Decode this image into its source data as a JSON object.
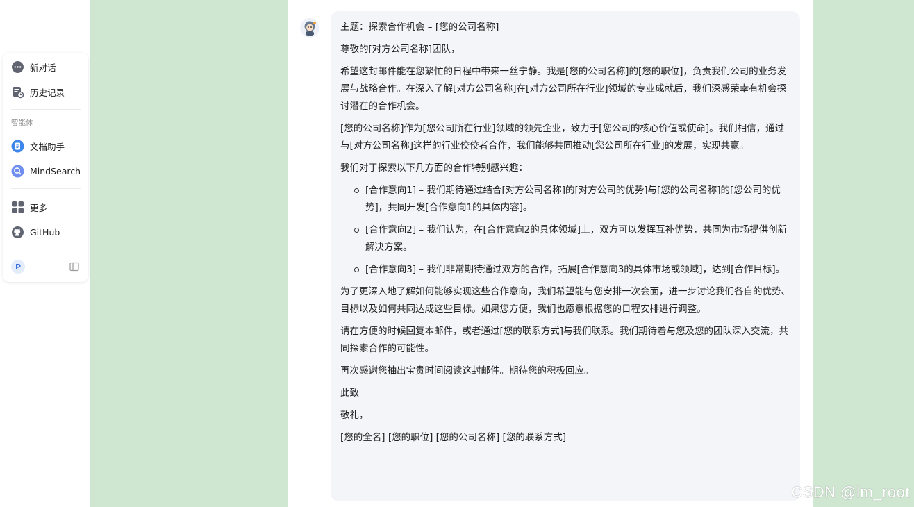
{
  "sidebar": {
    "new_chat": "新对话",
    "history": "历史记录",
    "section_agents": "智能体",
    "doc_assistant": "文档助手",
    "mindsearch": "MindSearch",
    "more": "更多",
    "github": "GitHub",
    "user_initial": "P"
  },
  "message": {
    "subject": "主题：探索合作机会 – [您的公司名称]",
    "greeting": "尊敬的[对方公司名称]团队，",
    "para1": "希望这封邮件能在您繁忙的日程中带来一丝宁静。我是[您的公司名称]的[您的职位]，负责我们公司的业务发展与战略合作。在深入了解[对方公司名称]在[对方公司所在行业]领域的专业成就后，我们深感荣幸有机会探讨潜在的合作机会。",
    "para2": "[您的公司名称]作为[您公司所在行业]领域的领先企业，致力于[您公司的核心价值或使命]。我们相信，通过与[对方公司名称]这样的行业佼佼者合作，我们能够共同推动[您公司所在行业]的发展，实现共赢。",
    "para3": "我们对于探索以下几方面的合作特别感兴趣：",
    "bullets": [
      "[合作意向1] – 我们期待通过结合[对方公司名称]的[对方公司的优势]与[您的公司名称]的[您公司的优势]，共同开发[合作意向1的具体内容]。",
      "[合作意向2] – 我们认为，在[合作意向2的具体领域]上，双方可以发挥互补优势，共同为市场提供创新解决方案。",
      "[合作意向3] – 我们非常期待通过双方的合作，拓展[合作意向3的具体市场或领域]，达到[合作目标]。"
    ],
    "para4": "为了更深入地了解如何能够实现这些合作意向，我们希望能与您安排一次会面，进一步讨论我们各自的优势、目标以及如何共同达成这些目标。如果您方便，我们也愿意根据您的日程安排进行调整。",
    "para5": "请在方便的时候回复本邮件，或者通过[您的联系方式]与我们联系。我们期待着与您及您的团队深入交流，共同探索合作的可能性。",
    "para6": "再次感谢您抽出宝贵时间阅读这封邮件。期待您的积极回应。",
    "closing1": "此致",
    "closing2": "敬礼，",
    "signature": "[您的全名] [您的职位] [您的公司名称] [您的联系方式]"
  },
  "watermark": "CSDN @lm_root",
  "colors": {
    "background_green": "#cfe7d1",
    "bubble": "#f4f5f9",
    "accent_blue": "#3b6fd9"
  }
}
